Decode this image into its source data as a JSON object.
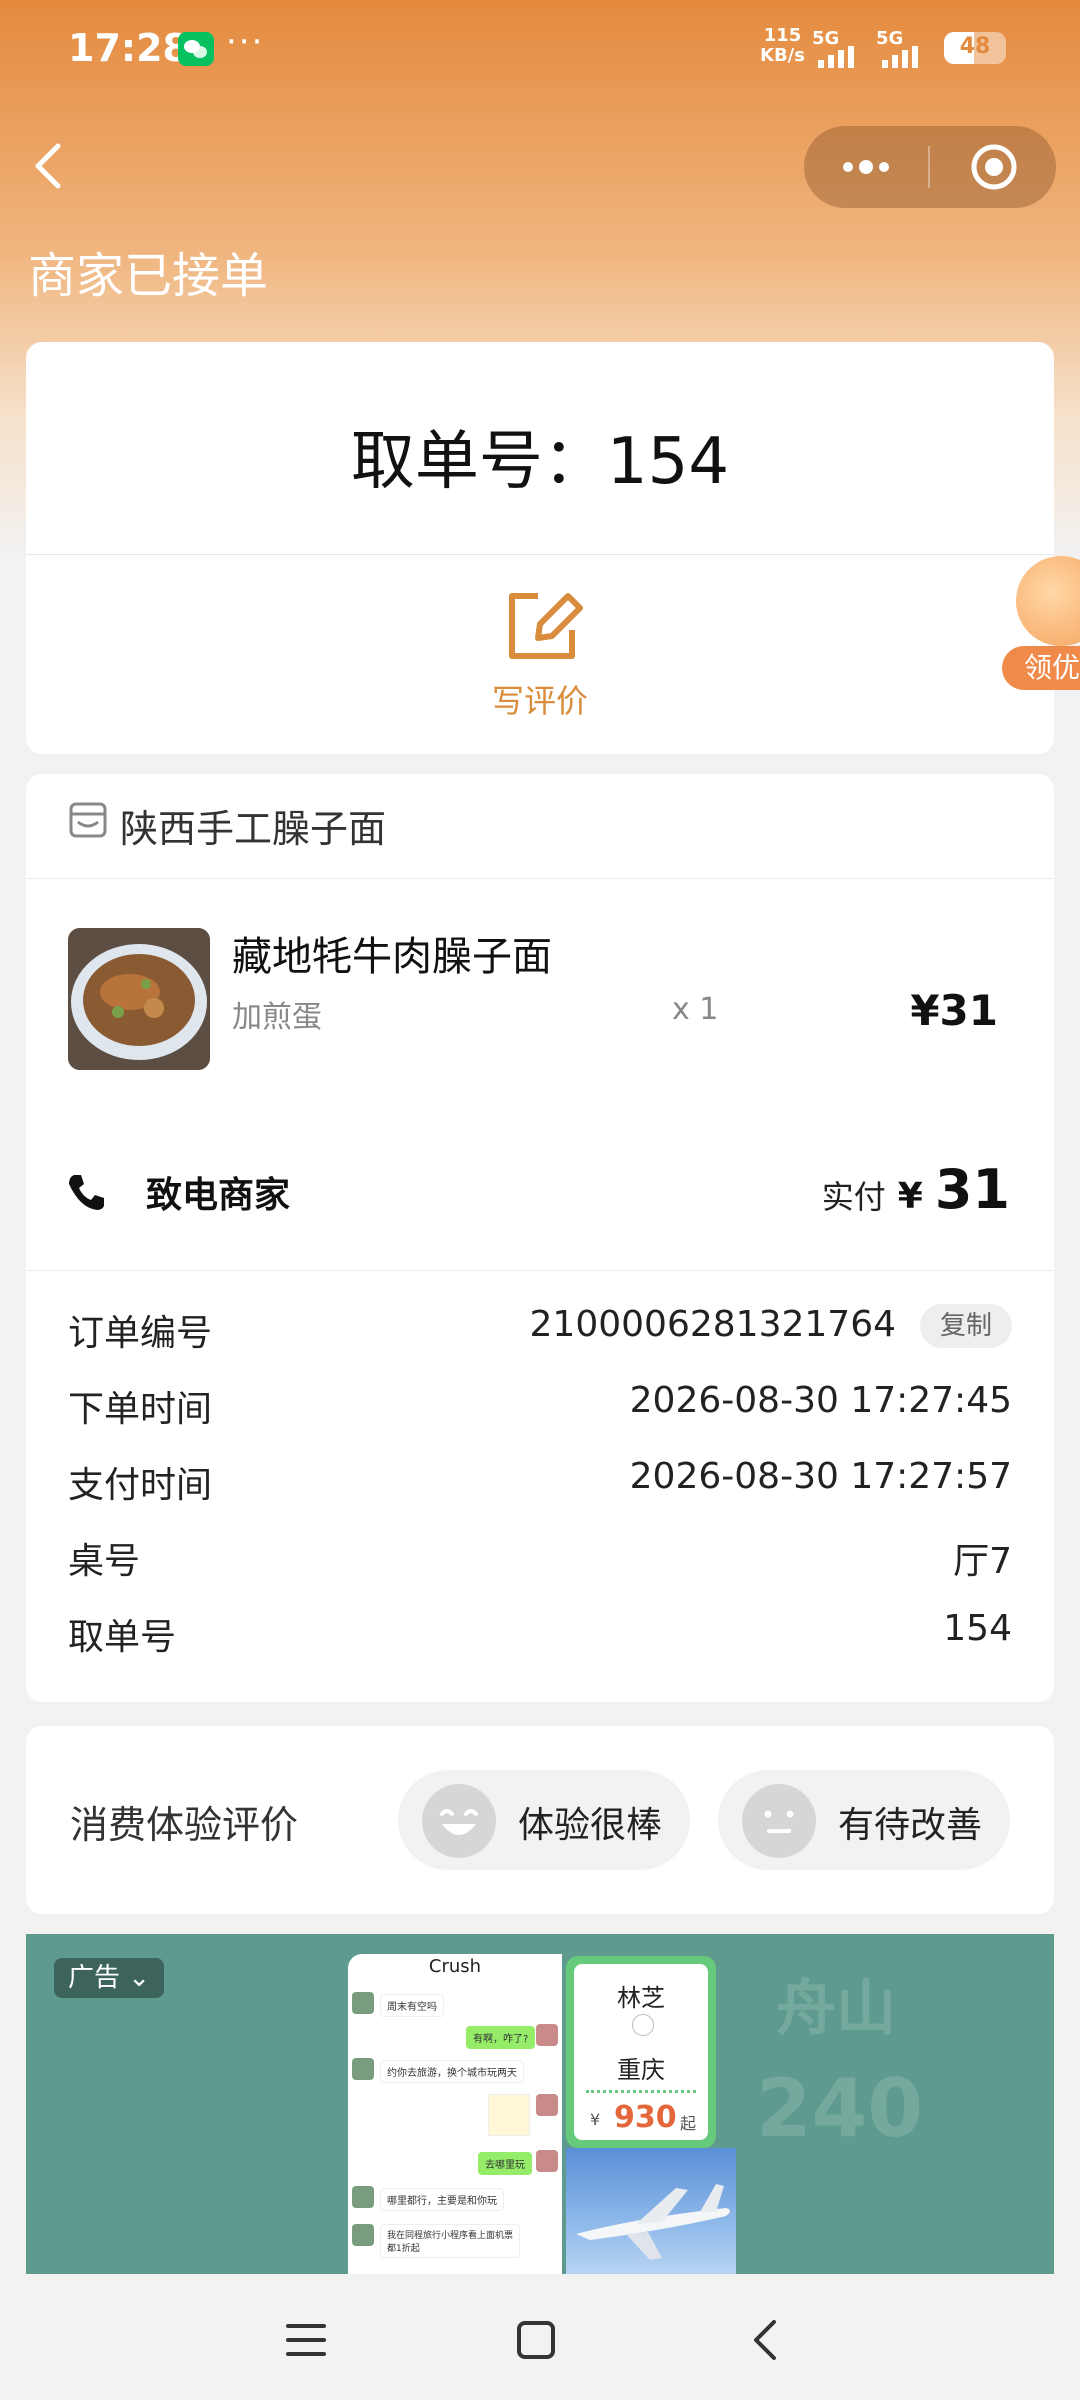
{
  "status_bar": {
    "time": "17:28",
    "more": "···",
    "net_speed_value": "115",
    "net_speed_unit": "KB/s",
    "signal1_label": "5G",
    "signal2_label": "5G",
    "battery": "48",
    "battery_level": 0.48
  },
  "header": {
    "title": "商家已接单"
  },
  "pickup": {
    "text": "取单号：154",
    "review_label": "写评价",
    "float_label": "领优"
  },
  "order": {
    "shop_name": "陕西手工臊子面",
    "item": {
      "name": "藏地牦牛肉臊子面",
      "option": "加煎蛋",
      "qty": "x 1",
      "price": "¥31"
    },
    "call_label": "致电商家",
    "paid_label": "实付",
    "paid_currency": "¥",
    "paid_value": "31",
    "info": {
      "order_no_label": "订单编号",
      "order_no": "2100006281321764",
      "copy_label": "复制",
      "order_time_label": "下单时间",
      "order_time": "2026-08-30 17:27:45",
      "pay_time_label": "支付时间",
      "pay_time": "2026-08-30 17:27:57",
      "table_label": "桌号",
      "table": "厅7",
      "pickup_label": "取单号",
      "pickup_no": "154"
    }
  },
  "experience": {
    "label": "消费体验评价",
    "good_label": "体验很棒",
    "improve_label": "有待改善"
  },
  "ad": {
    "tag": "广告",
    "chat_title": "Crush",
    "bubbles": [
      "周末有空吗",
      "有啊，咋了?",
      "约你去旅游，换个城市玩两天",
      "去哪里玩",
      "哪里都行，主要是和你玩",
      "我在同程旅行小程序看上面机票都1折起"
    ],
    "ticket_from": "林芝",
    "ticket_to": "重庆",
    "ticket_currency": "¥",
    "ticket_price": "930",
    "ticket_suffix": "起",
    "bg_text_1": "舟山",
    "bg_text_2": "240"
  },
  "colors": {
    "accent": "#d98c3b",
    "header_gradient_top": "#e48a3e",
    "ad_bg": "#5e9a8e",
    "ticket_green": "#67c97a",
    "ticket_price": "#e4673b"
  }
}
